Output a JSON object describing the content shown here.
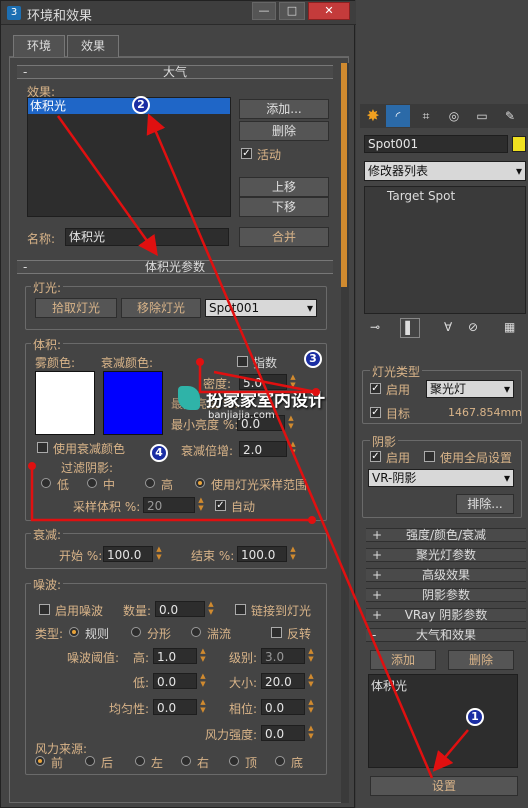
{
  "window": {
    "title": "环境和效果",
    "min": "—",
    "max": "□",
    "close": "✕"
  },
  "tabs": [
    "环境",
    "效果"
  ],
  "atmosphere": {
    "rollout": "大气",
    "effects_label": "效果:",
    "effects_list": [
      "体积光"
    ],
    "add": "添加...",
    "delete": "删除",
    "active": "活动",
    "move_up": "上移",
    "move_down": "下移",
    "name_label": "名称:",
    "name_value": "体积光",
    "merge": "合并",
    "minus": "-"
  },
  "volume_light": {
    "rollout": "体积光参数",
    "minus": "-",
    "lights": {
      "group": "灯光:",
      "pick": "拾取灯光",
      "remove": "移除灯光",
      "selected": "Spot001"
    },
    "volume": {
      "group": "体积:",
      "fog_color": "雾颜色:",
      "atten_color": "衰减颜色:",
      "fog_hex": "#ffffff",
      "atten_hex": "#0000ff",
      "exponent": "指数",
      "density_label": "密度:",
      "density": "5.0",
      "max_bright_label": "最大亮度 %:",
      "min_bright_label": "最小亮度 %:",
      "min_bright": "0.0",
      "atten_mult_label": "衰减倍增:",
      "atten_mult": "2.0",
      "use_atten_color": "使用衰减颜色",
      "filter_shadows": "过滤阴影:",
      "low": "低",
      "mid": "中",
      "high": "高",
      "use_light_rate": "使用灯光采样范围",
      "sample_vol_label": "采样体积 %:",
      "sample_vol": "20",
      "auto": "自动"
    },
    "atten": {
      "group": "衰减:",
      "start_label": "开始 %:",
      "start": "100.0",
      "end_label": "结束 %:",
      "end": "100.0"
    },
    "noise": {
      "group": "噪波:",
      "enable": "启用噪波",
      "amount_label": "数量:",
      "amount": "0.0",
      "link_light": "链接到灯光",
      "type_label": "类型:",
      "regular": "规则",
      "fractal": "分形",
      "turbulence": "湍流",
      "invert": "反转",
      "threshold_label": "噪波阈值:",
      "high_label": "高:",
      "high": "1.0",
      "levels_label": "级别:",
      "levels": "3.0",
      "low_label": "低:",
      "low": "0.0",
      "size_label": "大小:",
      "size": "20.0",
      "uniform_label": "均匀性:",
      "uniform": "0.0",
      "phase_label": "相位:",
      "phase": "0.0",
      "wind_strength_label": "风力强度:",
      "wind_strength": "0.0",
      "wind_source": "风力来源:",
      "dirs": [
        "前",
        "后",
        "左",
        "右",
        "顶",
        "底"
      ]
    }
  },
  "right": {
    "object_name": "Spot001",
    "object_color": "#f0e020",
    "modifier_list": "修改器列表",
    "stack_item": "Target Spot",
    "light_type": {
      "group": "灯光类型",
      "on": "启用",
      "type": "聚光灯",
      "target": "目标",
      "distance": "1467.854mm"
    },
    "shadows": {
      "group": "阴影",
      "on": "启用",
      "use_global": "使用全局设置",
      "type": "VR-阴影",
      "exclude": "排除..."
    },
    "rollouts": [
      {
        "p": "+",
        "t": "强度/颜色/衰减"
      },
      {
        "p": "+",
        "t": "聚光灯参数"
      },
      {
        "p": "+",
        "t": "高级效果"
      },
      {
        "p": "+",
        "t": "阴影参数"
      },
      {
        "p": "+",
        "t": "VRay 阴影参数"
      },
      {
        "p": "-",
        "t": "大气和效果"
      }
    ],
    "add": "添加",
    "delete": "删除",
    "atmo_item": "体积光",
    "setup": "设置"
  },
  "watermark": {
    "title": "扮家家室内设计",
    "url": "banjiajia.com"
  },
  "markers": [
    "1",
    "2",
    "3",
    "4"
  ]
}
